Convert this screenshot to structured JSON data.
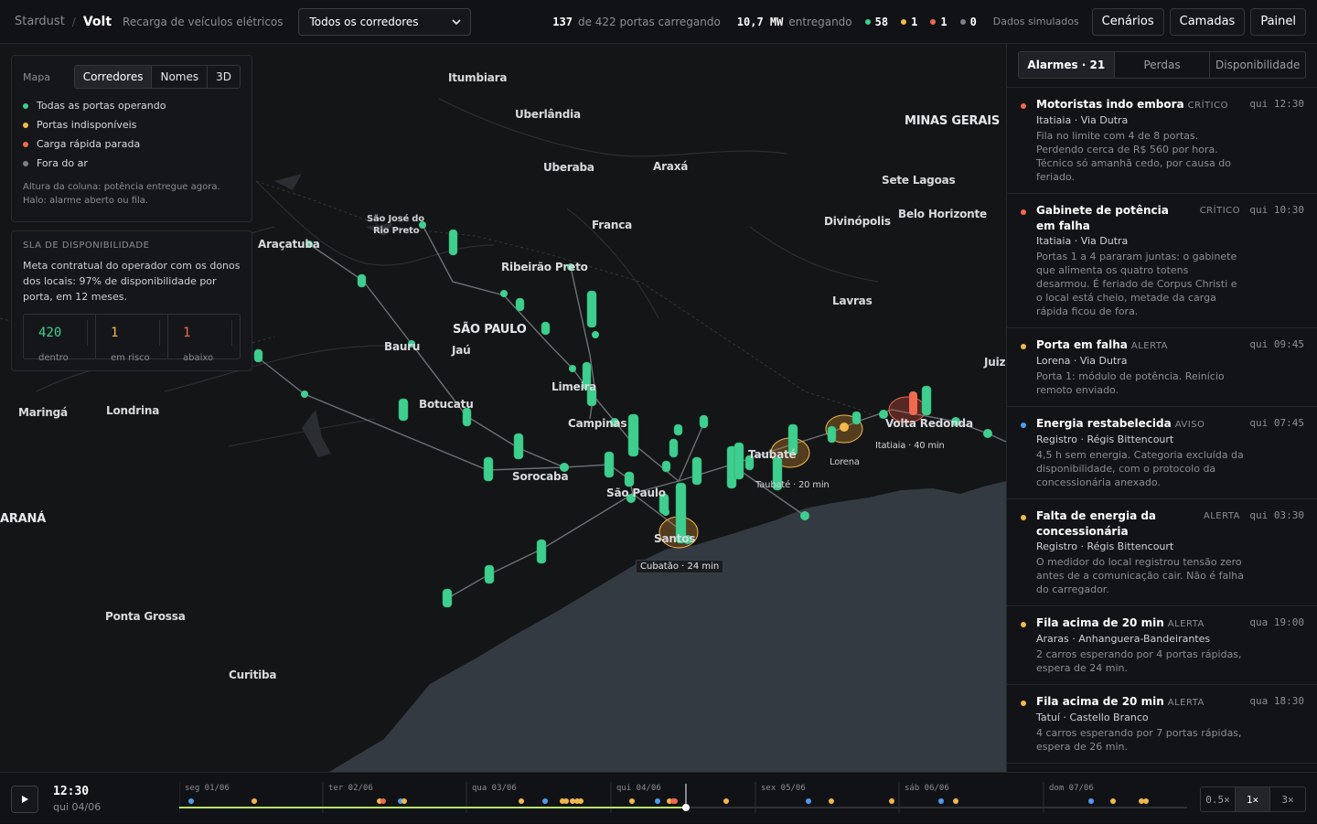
{
  "header": {
    "brand": "Stardust",
    "app": "Volt",
    "subtitle": "Recarga de veículos elétricos",
    "corridor_select": "Todos os corredores",
    "ports_charging": "137",
    "ports_charging_label": "de 422 portas carregando",
    "power": "10,7 MW",
    "power_label": "entregando",
    "counts": [
      {
        "value": "58",
        "color": "#3ecf8e"
      },
      {
        "value": "1",
        "color": "#f2b84b"
      },
      {
        "value": "1",
        "color": "#f06a4f"
      },
      {
        "value": "0",
        "color": "#7d8087"
      }
    ],
    "sim_label": "Dados simulados",
    "buttons": [
      "Cenários",
      "Camadas",
      "Painel"
    ]
  },
  "legend": {
    "title": "Mapa",
    "toggles": [
      "Corredores",
      "Nomes",
      "3D"
    ],
    "items": [
      {
        "label": "Todas as portas operando",
        "color": "#3ecf8e"
      },
      {
        "label": "Portas indisponíveis",
        "color": "#f2b84b"
      },
      {
        "label": "Carga rápida parada",
        "color": "#f06a4f"
      },
      {
        "label": "Fora do ar",
        "color": "#7d8087"
      }
    ],
    "note": "Altura da coluna: potência entregue agora. Halo: alarme aberto ou fila."
  },
  "sla": {
    "title": "SLA DE DISPONIBILIDADE",
    "desc": "Meta contratual do operador com os donos dos locais: 97% de disponibilidade por porta, em 12 meses.",
    "kpis": [
      {
        "value": "420",
        "label": "dentro",
        "color": "#3ecf8e"
      },
      {
        "value": "1",
        "label": "em risco",
        "color": "#f2b84b"
      },
      {
        "value": "1",
        "label": "abaixo",
        "color": "#f06a4f"
      }
    ]
  },
  "map": {
    "cities": [
      {
        "name": "Itumbiara"
      },
      {
        "name": "Uberlândia"
      },
      {
        "name": "MINAS GERAIS"
      },
      {
        "name": "Uberaba"
      },
      {
        "name": "Araxá"
      },
      {
        "name": "Sete Lagoas"
      },
      {
        "name": "São José do"
      },
      {
        "name": "Rio Preto"
      },
      {
        "name": "Franca"
      },
      {
        "name": "Divinópolis"
      },
      {
        "name": "Belo Horizonte"
      },
      {
        "name": "Araçatuba"
      },
      {
        "name": "Ribeirão Preto"
      },
      {
        "name": "SÃO PAULO"
      },
      {
        "name": "Lavras"
      },
      {
        "name": "Bauru"
      },
      {
        "name": "Jaú"
      },
      {
        "name": "Limeira"
      },
      {
        "name": "Juiz"
      },
      {
        "name": "Maringá"
      },
      {
        "name": "Londrina"
      },
      {
        "name": "Botucatu"
      },
      {
        "name": "Campinas"
      },
      {
        "name": "Volta Redonda"
      },
      {
        "name": "Taubaté"
      },
      {
        "name": "Sorocaba"
      },
      {
        "name": "São Paulo"
      },
      {
        "name": "Lorena"
      },
      {
        "name": "ARANÁ"
      },
      {
        "name": "Santos"
      },
      {
        "name": "Ponta Grossa"
      },
      {
        "name": "Curitiba"
      },
      {
        "name": "Itatiaia · 40 min"
      },
      {
        "name": "Taubaté · 20 min"
      }
    ],
    "callout": "Cubatão · 24 min"
  },
  "side": {
    "tabs": [
      "Alarmes · 21",
      "Perdas",
      "Disponibilidade"
    ],
    "alarms": [
      {
        "title": "Motoristas indo embora",
        "level": "CRÍTICO",
        "time": "qui 12:30",
        "color": "#f06a4f",
        "loc": "Itatiaia · Via Dutra",
        "desc": "Fila no limite com 4 de 8 portas. Perdendo cerca de R$ 560 por hora. Técnico só amanhã cedo, por causa do feriado."
      },
      {
        "title": "Gabinete de potência em falha",
        "level": "CRÍTICO",
        "time": "qui 10:30",
        "color": "#f06a4f",
        "loc": "Itatiaia · Via Dutra",
        "desc": "Portas 1 a 4 pararam juntas: o gabinete que alimenta os quatro totens desarmou. É feriado de Corpus Christi e o local está cheio, metade da carga rápida ficou de fora."
      },
      {
        "title": "Porta em falha",
        "level": "ALERTA",
        "time": "qui 09:45",
        "color": "#f2b84b",
        "loc": "Lorena · Via Dutra",
        "desc": "Porta 1: módulo de potência. Reinício remoto enviado."
      },
      {
        "title": "Energia restabelecida",
        "level": "AVISO",
        "time": "qui 07:45",
        "color": "#4f9cf0",
        "loc": "Registro · Régis Bittencourt",
        "desc": "4,5 h sem energia. Categoria excluída da disponibilidade, com o protocolo da concessionária anexado."
      },
      {
        "title": "Falta de energia da concessionária",
        "level": "ALERTA",
        "time": "qui 03:30",
        "color": "#f2b84b",
        "loc": "Registro · Régis Bittencourt",
        "desc": "O medidor do local registrou tensão zero antes de a comunicação cair. Não é falha do carregador."
      },
      {
        "title": "Fila acima de 20 min",
        "level": "ALERTA",
        "time": "qua 19:00",
        "color": "#f2b84b",
        "loc": "Araras · Anhanguera-Bandeirantes",
        "desc": "2 carros esperando por 4 portas rápidas, espera de 24 min."
      },
      {
        "title": "Fila acima de 20 min",
        "level": "ALERTA",
        "time": "qua 18:30",
        "color": "#f2b84b",
        "loc": "Tatuí · Castello Branco",
        "desc": "4 carros esperando por 7 portas rápidas, espera de 26 min."
      }
    ]
  },
  "timeline": {
    "time": "12:30",
    "date": "qui 04/06",
    "days": [
      "seg 01/06",
      "ter 02/06",
      "qua 03/06",
      "qui 04/06",
      "sex 05/06",
      "sáb 06/06",
      "dom 07/06"
    ],
    "speeds": [
      "0.5×",
      "1×",
      "3×"
    ],
    "active_speed": "1×"
  }
}
